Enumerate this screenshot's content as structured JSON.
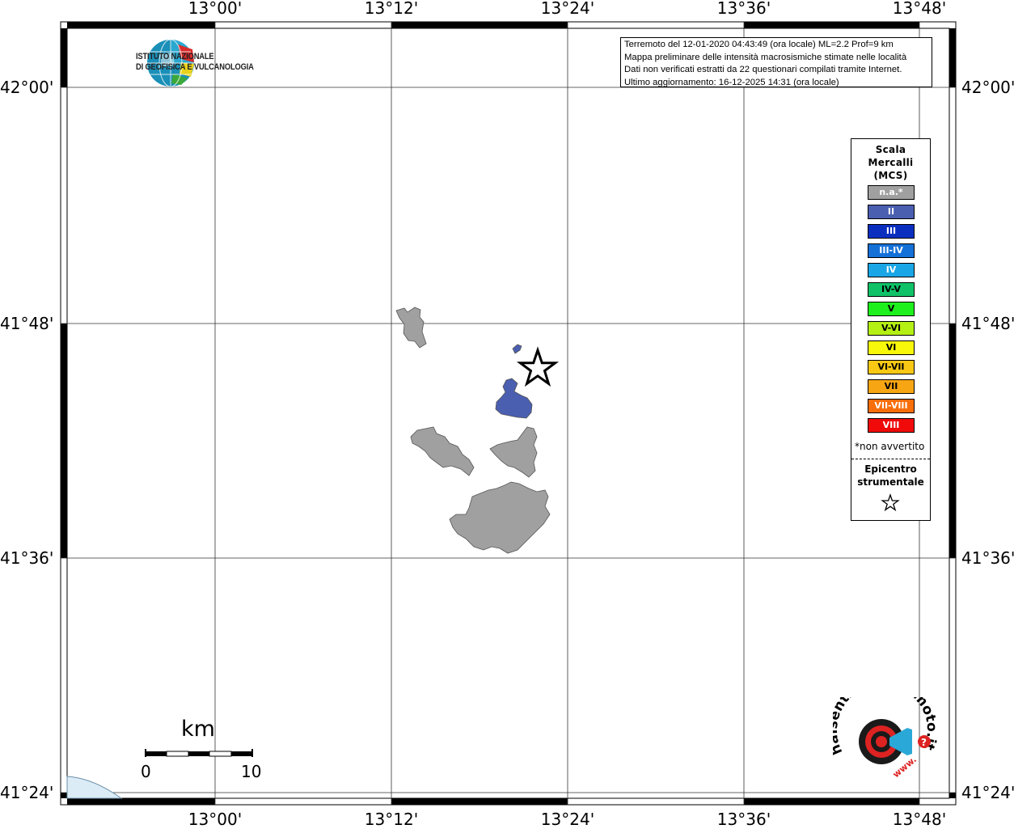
{
  "map": {
    "lon_labels": [
      "13°00'",
      "13°12'",
      "13°24'",
      "13°36'",
      "13°48'"
    ],
    "lat_labels": [
      "42°00'",
      "41°48'",
      "41°36'",
      "41°24'"
    ]
  },
  "info": {
    "line1": "Terremoto del 12-01-2020 04:43:49 (ora locale) ML=2.2 Prof=9 km",
    "line2": "Mappa preliminare delle intensità macrosismiche stimate nelle località",
    "line3": "Dati non verificati estratti da 22 questionari compilati tramite Internet.",
    "line4": "Ultimo aggiornamento: 16-12-2025 14:31 (ora locale)"
  },
  "logo": {
    "line1": "ISTITUTO NAZIONALE",
    "line2": "DI GEOFISICA E VULCANOLOGIA"
  },
  "legend": {
    "title_line1": "Scala",
    "title_line2": "Mercalli",
    "title_line3": "(MCS)",
    "items": [
      {
        "label": "n.a.*",
        "color": "#a0a0a0"
      },
      {
        "label": "II",
        "color": "#4a5fb0"
      },
      {
        "label": "III",
        "color": "#0a2fbf"
      },
      {
        "label": "III-IV",
        "color": "#1570d8"
      },
      {
        "label": "IV",
        "color": "#1aa6e6"
      },
      {
        "label": "IV-V",
        "color": "#0fc267"
      },
      {
        "label": "V",
        "color": "#1df01d"
      },
      {
        "label": "V-VI",
        "color": "#b4f014"
      },
      {
        "label": "VI",
        "color": "#f8f80a"
      },
      {
        "label": "VI-VII",
        "color": "#f8c814"
      },
      {
        "label": "VII",
        "color": "#f8a514"
      },
      {
        "label": "VII-VIII",
        "color": "#f86e0a"
      },
      {
        "label": "VIII",
        "color": "#f00a0a"
      }
    ],
    "note": "*non avvertito",
    "epicenter_line1": "Epicentro",
    "epicenter_line2": "strumentale"
  },
  "scalebar": {
    "unit": "km",
    "start": "0",
    "end": "10"
  },
  "hsit": {
    "text": "haisentitoilterremoto.it",
    "www": "www."
  }
}
